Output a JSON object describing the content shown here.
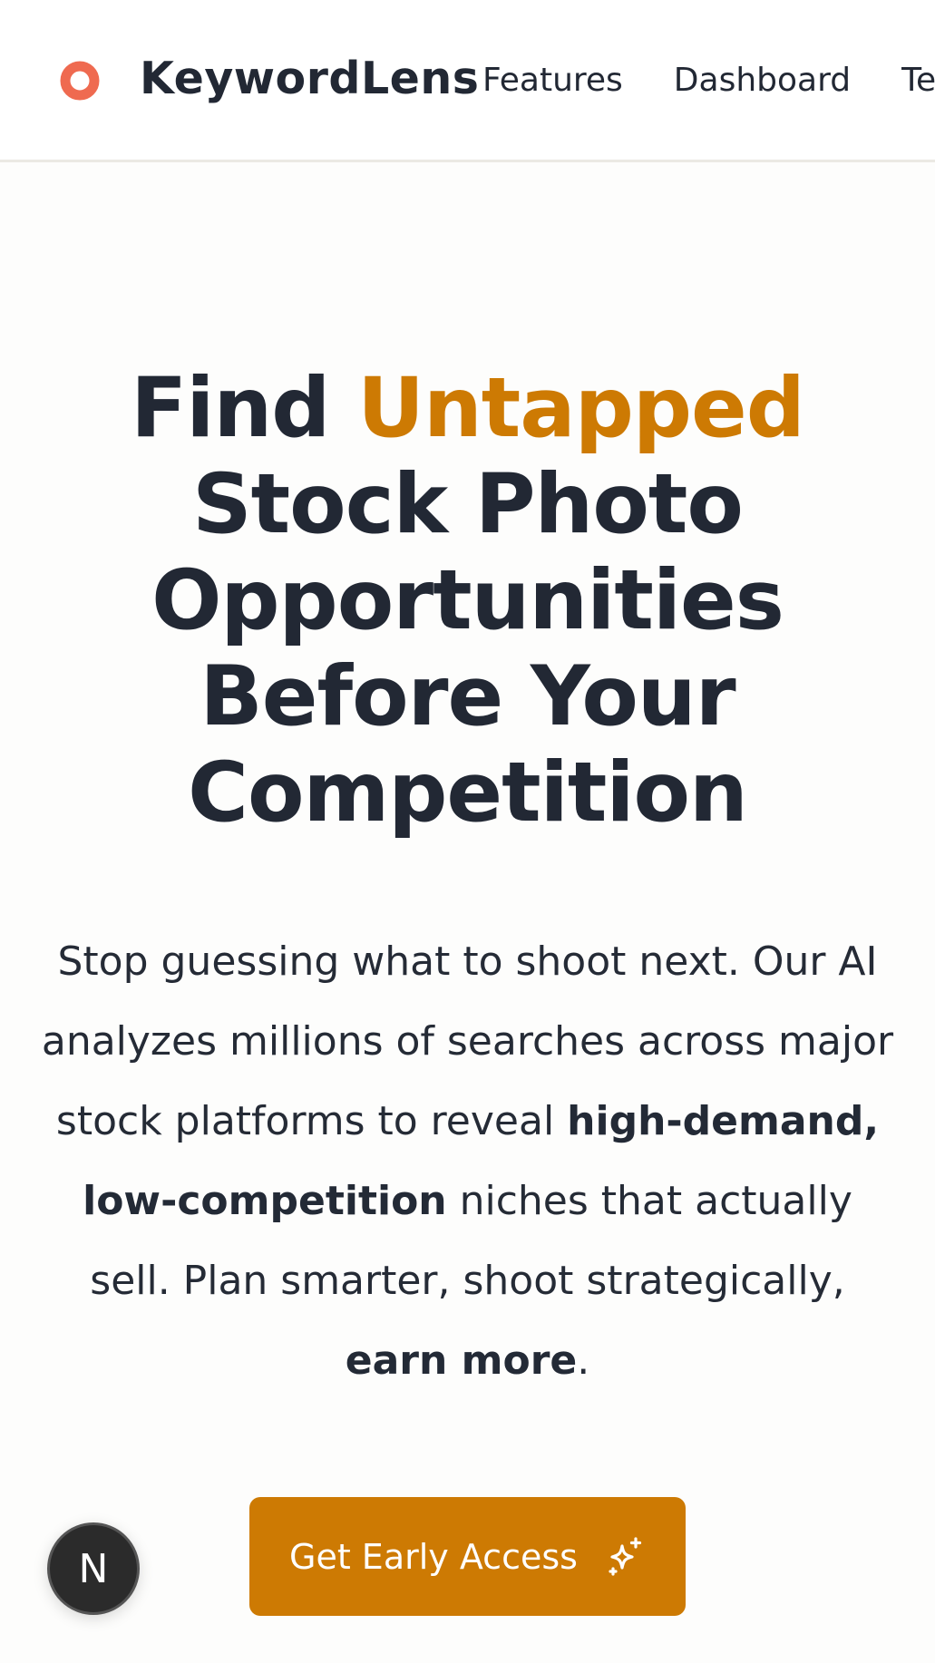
{
  "header": {
    "brand": "KeywordLens",
    "logo_icon": "ring-logo-icon",
    "nav": [
      "Features",
      "Dashboard",
      "Te"
    ]
  },
  "hero": {
    "title_part1": "Find ",
    "title_accent": "Untapped",
    "title_line2": "Stock Photo",
    "title_line3": "Opportunities",
    "title_line4": "Before Your",
    "title_line5": "Competition",
    "sub_1": "Stop guessing what to shoot next. Our AI analyzes millions of searches across major stock platforms to reveal ",
    "sub_bold_1": "high-demand, low-competition",
    "sub_2": " niches that actually sell. Plan smarter, shoot strategically, ",
    "sub_bold_2": "earn more",
    "sub_3": "."
  },
  "cta": {
    "label": "Get Early Access",
    "icon": "sparkles-icon"
  },
  "badge": {
    "letter": "N"
  },
  "colors": {
    "accent": "#cd7a03",
    "logo": "#ef6a50",
    "text": "#222834"
  }
}
